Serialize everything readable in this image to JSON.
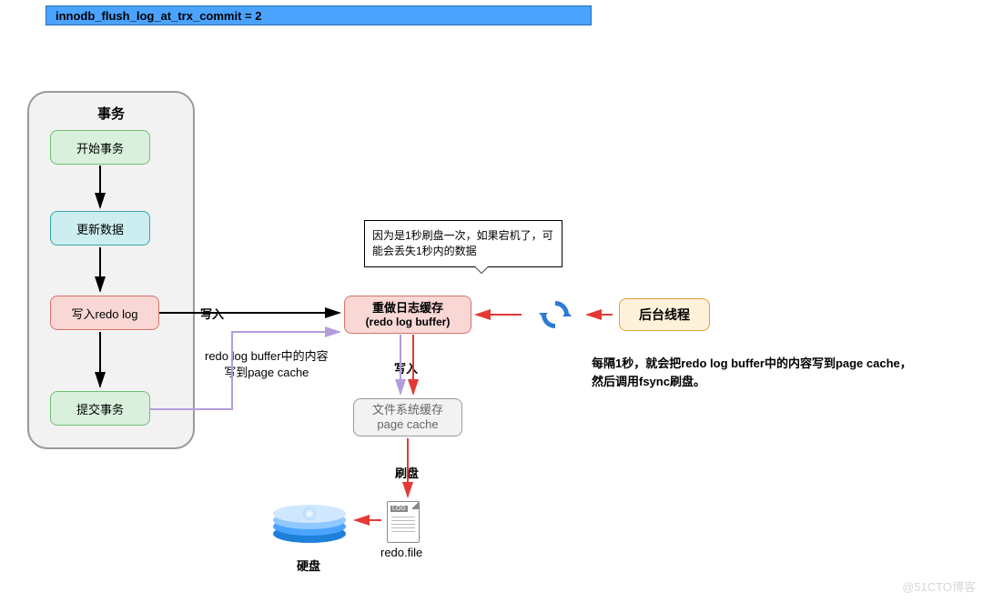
{
  "banner": "innodb_flush_log_at_trx_commit = 2",
  "tx": {
    "title": "事务",
    "start": "开始事务",
    "update": "更新数据",
    "write": "写入redo log",
    "commit": "提交事务"
  },
  "redo_buffer_l1": "重做日志缓存",
  "redo_buffer_l2": "(redo log buffer)",
  "page_cache_l1": "文件系统缓存",
  "page_cache_l2": "page cache",
  "bg_thread": "后台线程",
  "callout": "因为是1秒刷盘一次，如果宕机了，可能会丢失1秒内的数据",
  "labels": {
    "write1": "写入",
    "buffer_to_cache_l1": "redo log buffer中的内容",
    "buffer_to_cache_l2": "写到page cache",
    "write2": "写入",
    "flush": "刷盘",
    "disk": "硬盘",
    "redo_file": "redo.file",
    "bg_desc_l1": "每隔1秒，就会把redo log buffer中的内容写到page cache，",
    "bg_desc_l2": "然后调用fsync刷盘。"
  },
  "watermark": "@51CTO博客"
}
